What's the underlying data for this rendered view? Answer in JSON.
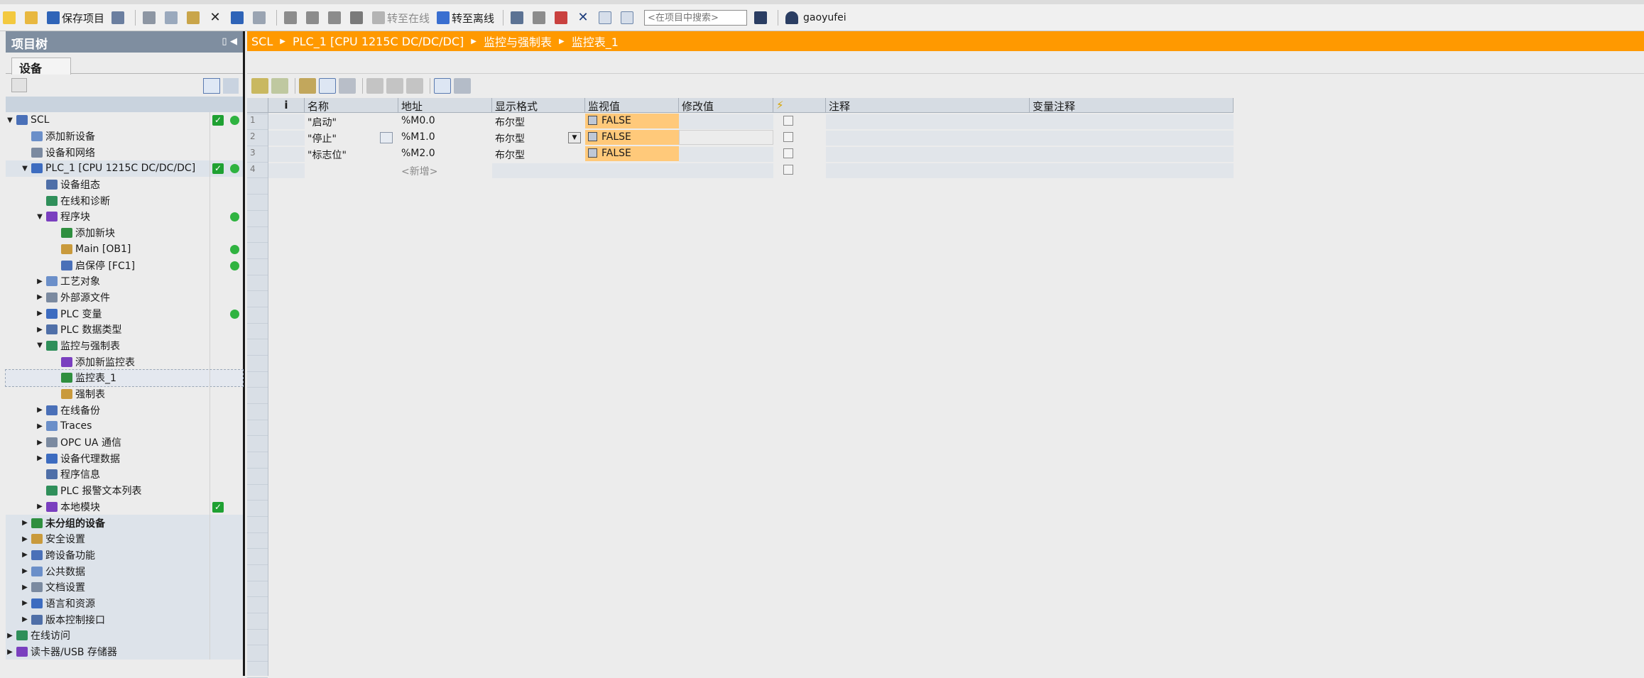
{
  "toolbar": {
    "save_project": "保存项目",
    "go_online": "转至在线",
    "go_offline": "转至离线",
    "search_placeholder": "<在项目中搜索>",
    "user": "gaoyufei"
  },
  "project_tree": {
    "title": "项目树",
    "tab_devices": "设备",
    "items": [
      {
        "label": "SCL",
        "indent": 0,
        "arrow": "down",
        "status": "check-dot"
      },
      {
        "label": "添加新设备",
        "indent": 1,
        "arrow": "",
        "status": ""
      },
      {
        "label": "设备和网络",
        "indent": 1,
        "arrow": "",
        "status": ""
      },
      {
        "label": "PLC_1 [CPU 1215C DC/DC/DC]",
        "indent": 1,
        "arrow": "down",
        "status": "check-dot",
        "group": true
      },
      {
        "label": "设备组态",
        "indent": 2,
        "arrow": "",
        "status": ""
      },
      {
        "label": "在线和诊断",
        "indent": 2,
        "arrow": "",
        "status": ""
      },
      {
        "label": "程序块",
        "indent": 2,
        "arrow": "down",
        "status": "dot"
      },
      {
        "label": "添加新块",
        "indent": 3,
        "arrow": "",
        "status": ""
      },
      {
        "label": "Main [OB1]",
        "indent": 3,
        "arrow": "",
        "status": "dot"
      },
      {
        "label": "启保停 [FC1]",
        "indent": 3,
        "arrow": "",
        "status": "dot"
      },
      {
        "label": "工艺对象",
        "indent": 2,
        "arrow": "right",
        "status": ""
      },
      {
        "label": "外部源文件",
        "indent": 2,
        "arrow": "right",
        "status": ""
      },
      {
        "label": "PLC 变量",
        "indent": 2,
        "arrow": "right",
        "status": "dot"
      },
      {
        "label": "PLC 数据类型",
        "indent": 2,
        "arrow": "right",
        "status": ""
      },
      {
        "label": "监控与强制表",
        "indent": 2,
        "arrow": "down",
        "status": ""
      },
      {
        "label": "添加新监控表",
        "indent": 3,
        "arrow": "",
        "status": ""
      },
      {
        "label": "监控表_1",
        "indent": 3,
        "arrow": "",
        "status": "",
        "selected": true
      },
      {
        "label": "强制表",
        "indent": 3,
        "arrow": "",
        "status": ""
      },
      {
        "label": "在线备份",
        "indent": 2,
        "arrow": "right",
        "status": ""
      },
      {
        "label": "Traces",
        "indent": 2,
        "arrow": "right",
        "status": ""
      },
      {
        "label": "OPC UA 通信",
        "indent": 2,
        "arrow": "right",
        "status": ""
      },
      {
        "label": "设备代理数据",
        "indent": 2,
        "arrow": "right",
        "status": ""
      },
      {
        "label": "程序信息",
        "indent": 2,
        "arrow": "",
        "status": ""
      },
      {
        "label": "PLC 报警文本列表",
        "indent": 2,
        "arrow": "",
        "status": ""
      },
      {
        "label": "本地模块",
        "indent": 2,
        "arrow": "right",
        "status": "check"
      },
      {
        "label": "未分组的设备",
        "indent": 1,
        "arrow": "right",
        "status": "",
        "group": true,
        "bold": true
      },
      {
        "label": "安全设置",
        "indent": 1,
        "arrow": "right",
        "status": "",
        "group": true
      },
      {
        "label": "跨设备功能",
        "indent": 1,
        "arrow": "right",
        "status": "",
        "group": true
      },
      {
        "label": "公共数据",
        "indent": 1,
        "arrow": "right",
        "status": "",
        "group": true
      },
      {
        "label": "文档设置",
        "indent": 1,
        "arrow": "right",
        "status": "",
        "group": true
      },
      {
        "label": "语言和资源",
        "indent": 1,
        "arrow": "right",
        "status": "",
        "group": true
      },
      {
        "label": "版本控制接口",
        "indent": 1,
        "arrow": "right",
        "status": "",
        "group": true
      },
      {
        "label": "在线访问",
        "indent": 0,
        "arrow": "right",
        "status": "",
        "group": true
      },
      {
        "label": "读卡器/USB 存储器",
        "indent": 0,
        "arrow": "right",
        "status": "",
        "group": true
      }
    ]
  },
  "breadcrumb": [
    "SCL",
    "PLC_1 [CPU 1215C DC/DC/DC]",
    "监控与强制表",
    "监控表_1"
  ],
  "watch_table": {
    "columns": [
      "i",
      "名称",
      "地址",
      "显示格式",
      "监视值",
      "修改值",
      "",
      "注释",
      "变量注释"
    ],
    "rows": [
      {
        "num": "1",
        "name": "\"启动\"",
        "address": "%M0.0",
        "format": "布尔型",
        "monitor": "FALSE"
      },
      {
        "num": "2",
        "name": "\"停止\"",
        "address": "%M1.0",
        "format": "布尔型",
        "monitor": "FALSE"
      },
      {
        "num": "3",
        "name": "\"标志位\"",
        "address": "%M2.0",
        "format": "布尔型",
        "monitor": "FALSE"
      },
      {
        "num": "4",
        "name": "",
        "address": "<新增>",
        "format": "",
        "monitor": ""
      }
    ]
  }
}
